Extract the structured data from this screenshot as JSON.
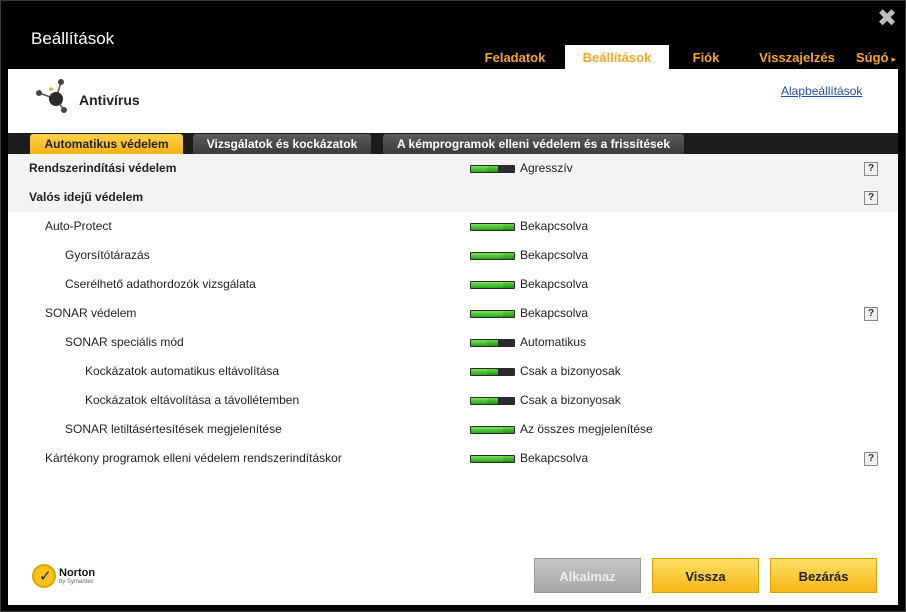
{
  "window": {
    "title": "Beállítások"
  },
  "topnav": {
    "tabs": [
      "Feladatok",
      "Beállítások",
      "Fiók",
      "Visszajelzés",
      "Súgó"
    ],
    "active": "Beállítások",
    "help_arrow": "▸"
  },
  "section": {
    "title": "Antivírus",
    "defaults_link": "Alapbeállítások"
  },
  "subtabs": {
    "items": [
      "Automatikus védelem",
      "Vizsgálatok és kockázatok",
      "A kémprogramok elleni védelem és a frissítések"
    ],
    "active": "Automatikus védelem"
  },
  "rows": [
    {
      "label": "Rendszerindítási védelem",
      "value": "Agresszív",
      "help": "?"
    },
    {
      "label": "Valós idejű védelem",
      "help": "?"
    },
    {
      "label": "Auto-Protect",
      "value": "Bekapcsolva"
    },
    {
      "label": "Gyorsítótárazás",
      "value": "Bekapcsolva"
    },
    {
      "label": "Cserélhető adathordozók vizsgálata",
      "value": "Bekapcsolva"
    },
    {
      "label": "SONAR védelem",
      "value": "Bekapcsolva",
      "help": "?"
    },
    {
      "label": "SONAR speciális mód",
      "value": "Automatikus"
    },
    {
      "label": "Kockázatok automatikus eltávolítása",
      "value": "Csak a bizonyosak"
    },
    {
      "label": "Kockázatok eltávolítása a távollétemben",
      "value": "Csak a bizonyosak"
    },
    {
      "label": "SONAR letiltásértesítések megjelenítése",
      "value": "Az összes megjelenítése"
    },
    {
      "label": "Kártékony programok elleni védelem rendszerindításkor",
      "value": "Bekapcsolva",
      "help": "?"
    }
  ],
  "sliders": [
    {
      "row": 0,
      "level": 0.5
    },
    {
      "row": 2,
      "level": 1.0
    },
    {
      "row": 3,
      "level": 1.0
    },
    {
      "row": 4,
      "level": 1.0
    },
    {
      "row": 5,
      "level": 1.0
    },
    {
      "row": 6,
      "level": 0.5
    },
    {
      "row": 7,
      "level": 0.5
    },
    {
      "row": 8,
      "level": 0.5
    },
    {
      "row": 9,
      "level": 1.0
    },
    {
      "row": 10,
      "level": 1.0
    }
  ],
  "branding": {
    "name": "Norton",
    "by": "by Symantec"
  },
  "buttons": {
    "apply": "Alkalmaz",
    "back": "Vissza",
    "close": "Bezárás"
  },
  "colors": {
    "accent": "#f5a623",
    "button": "#f5b716",
    "slider_on": "#26a61a"
  }
}
